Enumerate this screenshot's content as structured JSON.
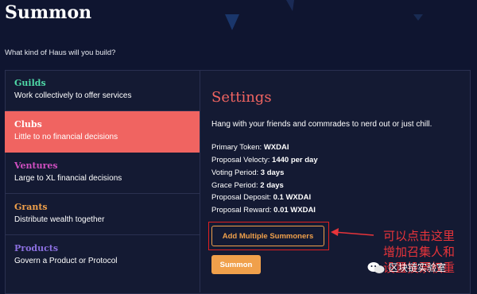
{
  "header": {
    "title": "Summon",
    "question": "What kind of Haus will you build?"
  },
  "options": [
    {
      "name": "Guilds",
      "desc": "Work collectively to offer services",
      "color": "#4fd9a7"
    },
    {
      "name": "Clubs",
      "desc": "Little to no financial decisions",
      "color": "#ffffff"
    },
    {
      "name": "Ventures",
      "desc": "Large to XL financial decisions",
      "color": "#cf4fc0"
    },
    {
      "name": "Grants",
      "desc": "Distribute wealth together",
      "color": "#f0a04b"
    },
    {
      "name": "Products",
      "desc": "Govern a Product or Protocol",
      "color": "#8b6fe0"
    }
  ],
  "settings": {
    "title": "Settings",
    "description": "Hang with your friends and commrades to nerd out or just chill.",
    "details": [
      {
        "label": "Primary Token:",
        "value": "WXDAI"
      },
      {
        "label": "Proposal Velocty:",
        "value": "1440 per day"
      },
      {
        "label": "Voting Period:",
        "value": "3 days"
      },
      {
        "label": "Grace Period:",
        "value": "2 days"
      },
      {
        "label": "Proposal Deposit:",
        "value": "0.1 WXDAI"
      },
      {
        "label": "Proposal Reward:",
        "value": "0.01 WXDAI"
      }
    ],
    "add_button": "Add Multiple Summoners",
    "summon_button": "Summon"
  },
  "annotation": {
    "line1": "可以点击这里",
    "line2": "增加召集人和",
    "line3": "设置投票权重"
  },
  "watermark": "区块链实验室",
  "colors": {
    "background": "#0f1530",
    "accent_active": "#f06461",
    "button": "#f0a04b",
    "annotation": "#e8343a"
  }
}
